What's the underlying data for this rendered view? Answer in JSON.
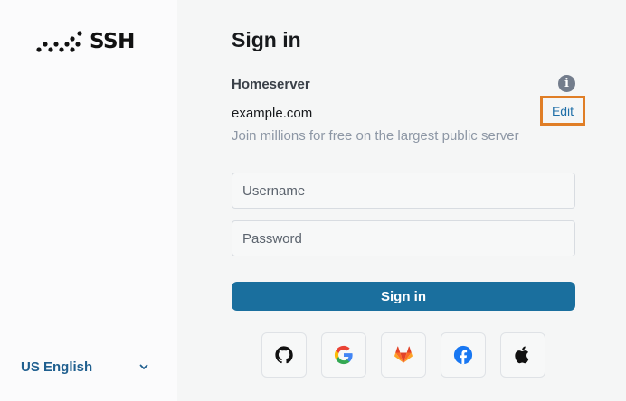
{
  "brand": {
    "logo_text": "SSH"
  },
  "language": {
    "label": "US English",
    "icon": "chevron-down-icon"
  },
  "auth": {
    "title": "Sign in",
    "homeserver_label": "Homeserver",
    "homeserver_value": "example.com",
    "edit_label": "Edit",
    "homeserver_description": "Join millions for free on the largest public server",
    "info_icon_glyph": "i",
    "username_placeholder": "Username",
    "password_placeholder": "Password",
    "submit_label": "Sign in"
  },
  "sso_providers": [
    {
      "name": "github",
      "icon": "github-icon"
    },
    {
      "name": "google",
      "icon": "google-icon"
    },
    {
      "name": "gitlab",
      "icon": "gitlab-icon"
    },
    {
      "name": "facebook",
      "icon": "facebook-icon"
    },
    {
      "name": "apple",
      "icon": "apple-icon"
    }
  ],
  "colors": {
    "accent": "#1a6f9e",
    "link": "#1f6fa8",
    "highlight": "#e07e26",
    "muted": "#8d97a5"
  }
}
